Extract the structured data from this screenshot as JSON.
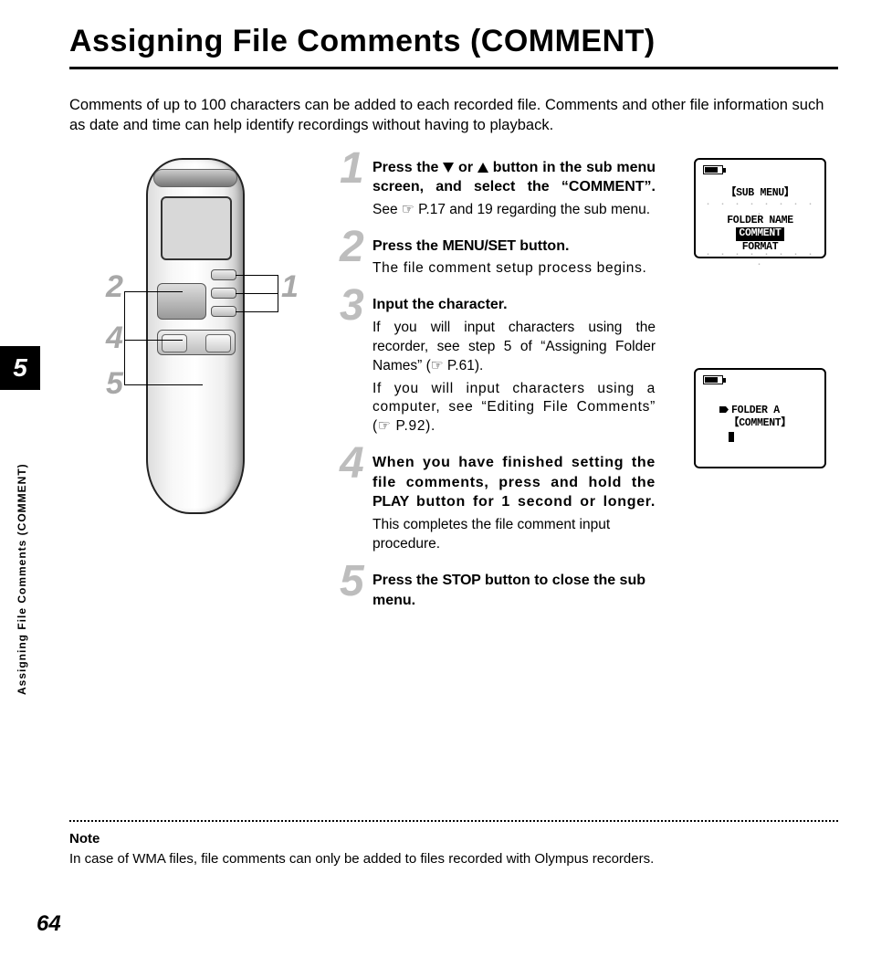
{
  "title": "Assigning File Comments (COMMENT)",
  "intro": "Comments of up to 100 characters can be added to each recorded file. Comments and other file information such as date and time can help identify recordings without having to playback.",
  "chapter": "5",
  "side_label": "Assigning File Comments (COMMENT)",
  "diagram": {
    "c1": "1",
    "c2": "2",
    "c4": "4",
    "c5": "5"
  },
  "steps": {
    "s1": {
      "num": "1",
      "head_a": "Press the ",
      "head_b": " or ",
      "head_c": " button in the sub menu screen, and select the “COMMENT”.",
      "body": "See ☞ P.17 and 19 regarding the sub menu."
    },
    "s2": {
      "num": "2",
      "head_a": "Press the ",
      "btn": "MENU/SET",
      "head_b": " button.",
      "body": "The file comment setup process begins."
    },
    "s3": {
      "num": "3",
      "head": "Input the character.",
      "body_a": "If you will input characters using the recorder, see step 5 of “Assigning Folder Names” (☞ P.61).",
      "body_b": "If you will input characters using a computer, see “Editing File Comments” (☞ P.92)."
    },
    "s4": {
      "num": "4",
      "head_a": "When you have finished setting the file comments, press and hold the ",
      "btn": "PLAY",
      "head_b": " button for 1 second or longer.",
      "body": "This completes the file comment input procedure."
    },
    "s5": {
      "num": "5",
      "head_a": "Press the ",
      "btn": "STOP",
      "head_b": " button to close the sub menu."
    }
  },
  "lcd1": {
    "l1": "【SUB MENU】",
    "l2": "FOLDER NAME",
    "l3": "COMMENT",
    "l4": "FORMAT"
  },
  "lcd2": {
    "l1": "FOLDER A",
    "l2": "【COMMENT】"
  },
  "note": {
    "label": "Note",
    "body": "In case of WMA files, file comments can only be added to files recorded with Olympus recorders."
  },
  "page_number": "64"
}
